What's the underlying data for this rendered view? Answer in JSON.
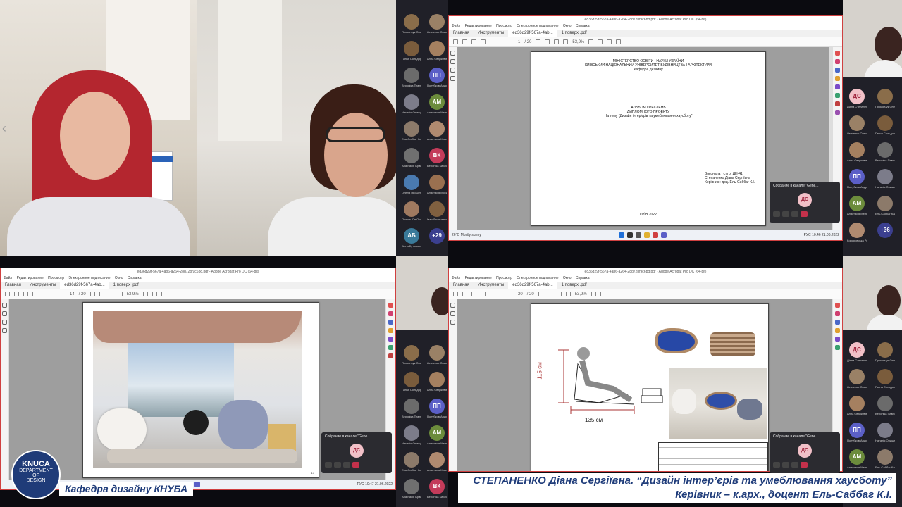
{
  "colors": {
    "accent": "#1f3c7a",
    "acrobat_red": "#d04040",
    "teams_end": "#c4314b"
  },
  "top_pdf": {
    "window_title": "ed36d29f-567a-4ab6-a264-28d72bf9c6bd.pdf - Adobe Acrobat Pro DC (64-bit)",
    "menu": [
      "Файл",
      "Редактирование",
      "Просмотр",
      "Электронное подписание",
      "Окно",
      "Справка"
    ],
    "tabs": [
      "Главная",
      "Инструменты",
      "ed36d29f-567a-4ab...",
      "1 поверх .pdf"
    ],
    "page_current": "1",
    "page_total": "/ 20",
    "zoom": "53,9%",
    "doc": {
      "ministry": "МІНІСТЕРСТВО ОСВІТИ І НАУКИ УКРАЇНИ",
      "university": "КИЇВСЬКИЙ НАЦІОНАЛЬНИЙ УНІВЕРСИТЕТ БУДІВНИЦТВА І АРХІТЕКТУРИ",
      "department": "Кафедра дизайну",
      "album_line1": "АЛЬБОМ КРЕСЛЕНЬ",
      "album_line2": "ДИПЛОМНОГО ПРОЕКТУ",
      "album_line3": "На тему \"Дизайн інтер'єрів та умеблювання хаусботу\"",
      "author_line1": "Виконала : ст.гр. ДН-41",
      "author_line2": "Степаненко Діана Сергіївна",
      "author_line3": "Керівник : доц. Ель-Саббаг К.І.",
      "city_year": "КИЇВ 2022"
    },
    "taskbar": {
      "weather": "26°C",
      "weather_desc": "Mostly sunny",
      "lang": "РУС",
      "time": "10:46",
      "date": "21.06.2022"
    }
  },
  "bottom_left_pdf": {
    "window_title": "ed36d29f-567a-4ab6-a264-28d72bf9c6bd.pdf - Adobe Acrobat Pro DC (64-bit)",
    "menu": [
      "Файл",
      "Редактирование",
      "Просмотр",
      "Электронное подписание",
      "Окно",
      "Справка"
    ],
    "tabs": [
      "Главная",
      "Инструменты",
      "ed36d29f-567a-4ab...",
      "1 поверх .pdf"
    ],
    "page_current": "14",
    "page_total": "/ 20",
    "zoom": "53,9%",
    "page_number": "13",
    "taskbar": {
      "lang": "РУС",
      "time": "10:47",
      "date": "21.06.2022"
    }
  },
  "bottom_right_pdf": {
    "window_title": "ed36d29f-567a-4ab6-a264-28d72bf9c6bd.pdf - Adobe Acrobat Pro DC (64-bit)",
    "menu": [
      "Файл",
      "Редактирование",
      "Просмотр",
      "Электронное подписание",
      "Окно",
      "Справка"
    ],
    "tabs": [
      "Главная",
      "Инструменты",
      "ed36d29f-567a-4ab...",
      "1 поверх .pdf"
    ],
    "page_current": "20",
    "page_total": "/ 20",
    "zoom": "53,9%",
    "dim_height": "115 см",
    "dim_width": "135 см"
  },
  "participants_left": [
    {
      "name": "Прокопчук Олексі...",
      "initials": "",
      "color": "#8a6d4a"
    },
    {
      "name": "Левченко Олексі...",
      "initials": "",
      "color": "#9a8166"
    },
    {
      "name": "Ганна Сольдор...",
      "initials": "",
      "color": "#7a5c3c"
    },
    {
      "name": "Анна Євдокимен...",
      "initials": "",
      "color": "#a58060"
    },
    {
      "name": "Вероніка Павлов...",
      "initials": "",
      "color": "#6b6b6b"
    },
    {
      "name": "Полубков Андрій...",
      "initials": "ПП",
      "color": "#5b5fc7"
    },
    {
      "name": "Наталія Онищенко...",
      "initials": "",
      "color": "#7c7c8a"
    },
    {
      "name": "Анастасія Мельн...",
      "initials": "АМ",
      "color": "#6c8c3c"
    },
    {
      "name": "Ель-Саббаг Касім...",
      "initials": "",
      "color": "#8c7a6a"
    },
    {
      "name": "Анастасія Кисел...",
      "initials": "",
      "color": "#b08a70"
    },
    {
      "name": "Анастасія Брацу...",
      "initials": "",
      "color": "#707070"
    },
    {
      "name": "Вероніка Кисляк...",
      "initials": "ВК",
      "color": "#c43b5a"
    },
    {
      "name": "Олена Ярошенко...",
      "initials": "",
      "color": "#4a7ab0"
    },
    {
      "name": "Анастасія Моска...",
      "initials": "",
      "color": "#9a7050"
    },
    {
      "name": "Поліна Юн Оксан...",
      "initials": "",
      "color": "#a07a60"
    },
    {
      "name": "Іван Люльченко...",
      "initials": "",
      "color": "#806040"
    },
    {
      "name": "Анна Бутоська",
      "initials": "АБ",
      "color": "#3a7a9a"
    },
    {
      "name": "",
      "initials": "+29",
      "color": "#3b3f8f"
    }
  ],
  "participants_right": [
    {
      "name": "Діана Степаненко",
      "initials": "ДС",
      "color": "#f2c1c8"
    },
    {
      "name": "Прокопчук Олексі...",
      "initials": "",
      "color": "#8a6d4a"
    },
    {
      "name": "Левченко Олексі...",
      "initials": "",
      "color": "#9a8166"
    },
    {
      "name": "Ганна Сольдор...",
      "initials": "",
      "color": "#7a5c3c"
    },
    {
      "name": "Анна Євдокимен...",
      "initials": "",
      "color": "#a58060"
    },
    {
      "name": "Вероніка Павлов...",
      "initials": "",
      "color": "#6b6b6b"
    },
    {
      "name": "Полубков Андрій...",
      "initials": "ПП",
      "color": "#5b5fc7"
    },
    {
      "name": "Наталія Онищенко...",
      "initials": "",
      "color": "#7c7c8a"
    },
    {
      "name": "Анастасія Мельн...",
      "initials": "АМ",
      "color": "#6c8c3c"
    },
    {
      "name": "Ель-Саббаг Касім...",
      "initials": "",
      "color": "#8c7a6a"
    },
    {
      "name": "Коноровська Роб...",
      "initials": "",
      "color": "#b08a70"
    },
    {
      "name": "",
      "initials": "+36",
      "color": "#3b3f8f"
    }
  ],
  "call_popup": {
    "title": "Собрание в канале \"Gene...",
    "initials": "ДС"
  },
  "logo": {
    "line1": "KNUCA",
    "line2": "DEPARTMENT",
    "line3": "OF",
    "line4": "DESIGN"
  },
  "caption_left": "Кафедра дизайну КНУБА",
  "caption_right_line1": "СТЕПАНЕНКО Діана Сергіївна. “Дизайн інтер’єрів та умеблювання хаусботу”",
  "caption_right_line2": "Керівник – к.арх., доцент Ель-Саббаг К.І."
}
